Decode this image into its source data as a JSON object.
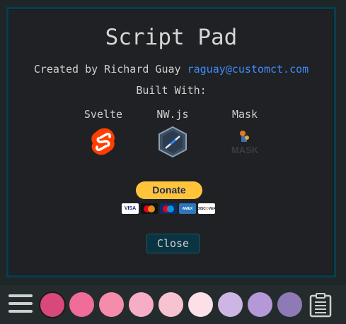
{
  "modal": {
    "title": "Script Pad",
    "created_by": "Created by Richard Guay",
    "email": "raguay@customct.com",
    "built_with": "Built With:",
    "tech": [
      {
        "label": "Svelte",
        "icon": "svelte-logo-icon"
      },
      {
        "label": "NW.js",
        "icon": "nwjs-logo-icon"
      },
      {
        "label": "Mask",
        "icon": "mask-logo-icon"
      }
    ],
    "donate_label": "Donate",
    "cards": [
      "VISA",
      "MC",
      "MC",
      "AMEX",
      "DISCOVER"
    ],
    "close_label": "Close"
  },
  "toolbar": {
    "swatches": [
      "#d9487a",
      "#f06d99",
      "#f58cab",
      "#f7adc6",
      "#f7c3d1",
      "#fbe0e8",
      "#cdb6e3",
      "#b598d7",
      "#8e7ab5"
    ],
    "active_swatch": 0
  },
  "colors": {
    "accent": "#3d8bff",
    "modal_border": "#0d3c4a",
    "paypal_yellow": "#ffc439"
  }
}
